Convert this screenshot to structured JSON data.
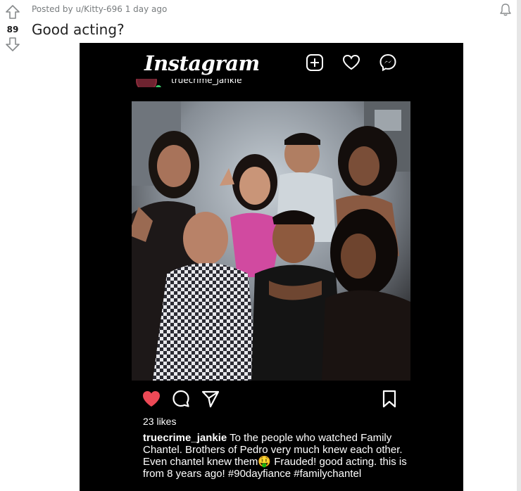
{
  "post": {
    "posted_by_prefix": "Posted by",
    "author": "u/Kitty-696",
    "time_ago": "1 day ago",
    "score": "89",
    "title": "Good acting?"
  },
  "instagram": {
    "logo_text": "Instagram",
    "username_cut": "truecrime_jankie",
    "likes": "23 likes",
    "caption_user": "truecrime_jankie",
    "caption_text": "To the people who watched Family Chantel. Brothers of Pedro very much knew each other. Even chantel knew them🤑 Frauded! good acting. this is from 8 years ago! #90dayfiance #familychantel",
    "heart_color": "#ed4956"
  }
}
